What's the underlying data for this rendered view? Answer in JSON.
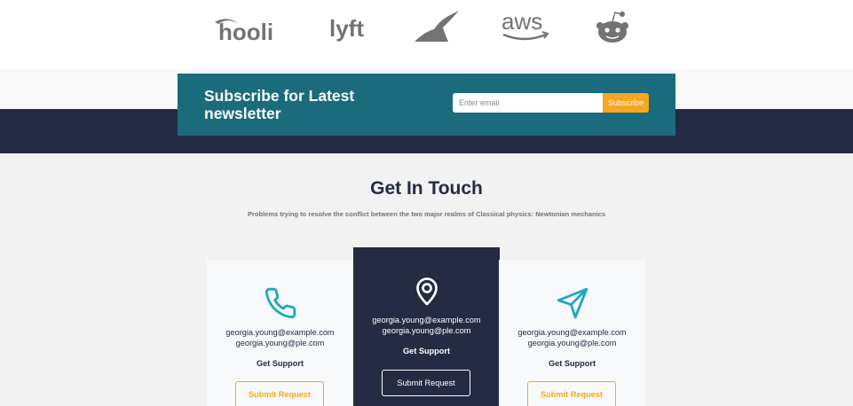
{
  "logos": [
    {
      "name": "hooli",
      "text": "hooli"
    },
    {
      "name": "lyft",
      "text": "lyft"
    },
    {
      "name": "stripe",
      "text": ""
    },
    {
      "name": "aws",
      "text": "aws"
    },
    {
      "name": "reddit",
      "text": ""
    }
  ],
  "newsletter": {
    "title": "Subscribe for Latest newsletter",
    "input_placeholder": "Enter email",
    "button_label": "Subscribe"
  },
  "contact": {
    "title": "Get In Touch",
    "subtitle": "Problems trying to resolve the conflict between the two major realms of Classical physics: Newtonian mechanics",
    "cards": [
      {
        "icon": "phone-icon",
        "emails": [
          "georgia.young@example.com",
          "georgia.young@ple.com"
        ],
        "label": "Get Support",
        "button": "Submit Request"
      },
      {
        "icon": "location-pin-icon",
        "emails": [
          "georgia.young@example.com",
          "georgia.young@ple.com"
        ],
        "label": "Get Support",
        "button": "Submit Request"
      },
      {
        "icon": "send-icon",
        "emails": [
          "georgia.young@example.com",
          "georgia.young@ple.com"
        ],
        "label": "Get Support",
        "button": "Submit Request"
      }
    ]
  },
  "colors": {
    "dark_navy": "#252b42",
    "teal": "#1a6b7c",
    "orange": "#f5a623",
    "icon_teal": "#23a6c4",
    "logo_gray": "#737373"
  }
}
